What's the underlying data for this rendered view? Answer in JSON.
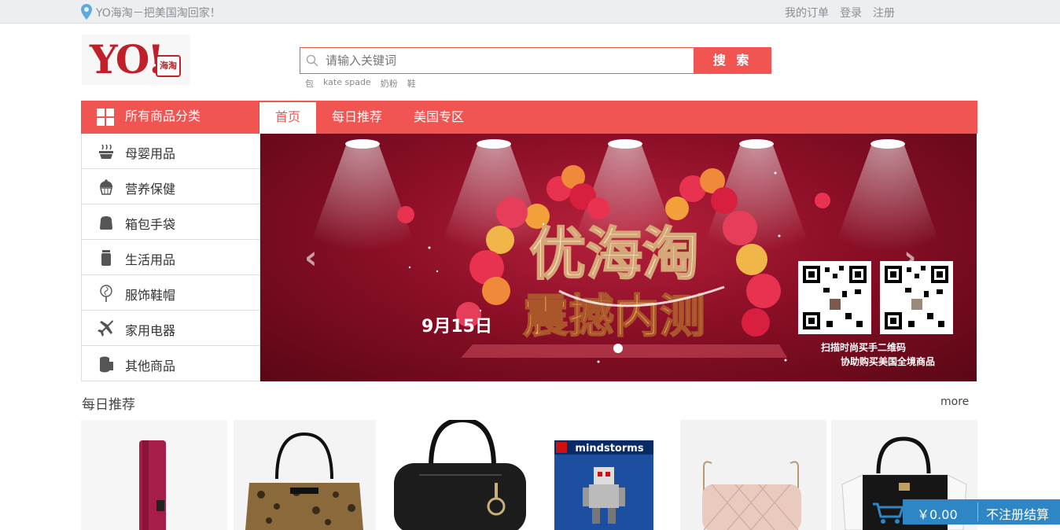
{
  "topbar": {
    "slogan": "YO海淘－把美国淘回家！",
    "links": [
      "我的订单",
      "登录",
      "注册"
    ]
  },
  "logo": {
    "text": "YO!",
    "badge": "海淘"
  },
  "search": {
    "placeholder": "请输入关键词",
    "button": "搜 索",
    "hot_keywords": [
      "包",
      "kate spade",
      "奶粉",
      "鞋"
    ]
  },
  "nav": {
    "all_categories": "所有商品分类",
    "tabs": [
      {
        "label": "首页",
        "active": true
      },
      {
        "label": "每日推荐",
        "active": false
      },
      {
        "label": "美国专区",
        "active": false
      }
    ]
  },
  "categories": [
    {
      "label": "母婴用品",
      "icon": "bowl-icon"
    },
    {
      "label": "营养保健",
      "icon": "cupcake-icon"
    },
    {
      "label": "箱包手袋",
      "icon": "bag-icon"
    },
    {
      "label": "生活用品",
      "icon": "jar-icon"
    },
    {
      "label": "服饰鞋帽",
      "icon": "lollipop-icon"
    },
    {
      "label": "家用电器",
      "icon": "airplane-icon"
    },
    {
      "label": "其他商品",
      "icon": "tissue-roll-icon"
    }
  ],
  "banner": {
    "headline": "优海淘",
    "subheadline": "震撼内测",
    "date": "9月15日",
    "qr_caption_1": "扫描时尚买手二维码",
    "qr_caption_2": "协助购买美国全境商品",
    "slides_total": 1,
    "slide_active": 1
  },
  "daily": {
    "title": "每日推荐",
    "more": "more",
    "products": [
      {
        "name": "red-umbrella"
      },
      {
        "name": "leopard-handbag"
      },
      {
        "name": "black-boston-bag"
      },
      {
        "name": "lego-mindstorms",
        "text": "mindstorms"
      },
      {
        "name": "quilted-pink-bag"
      },
      {
        "name": "black-white-handbag"
      }
    ]
  },
  "cart": {
    "amount": "￥0.00",
    "checkout": "不注册结算"
  },
  "colors": {
    "brand": "#f05552",
    "cart": "#2f86c5"
  }
}
